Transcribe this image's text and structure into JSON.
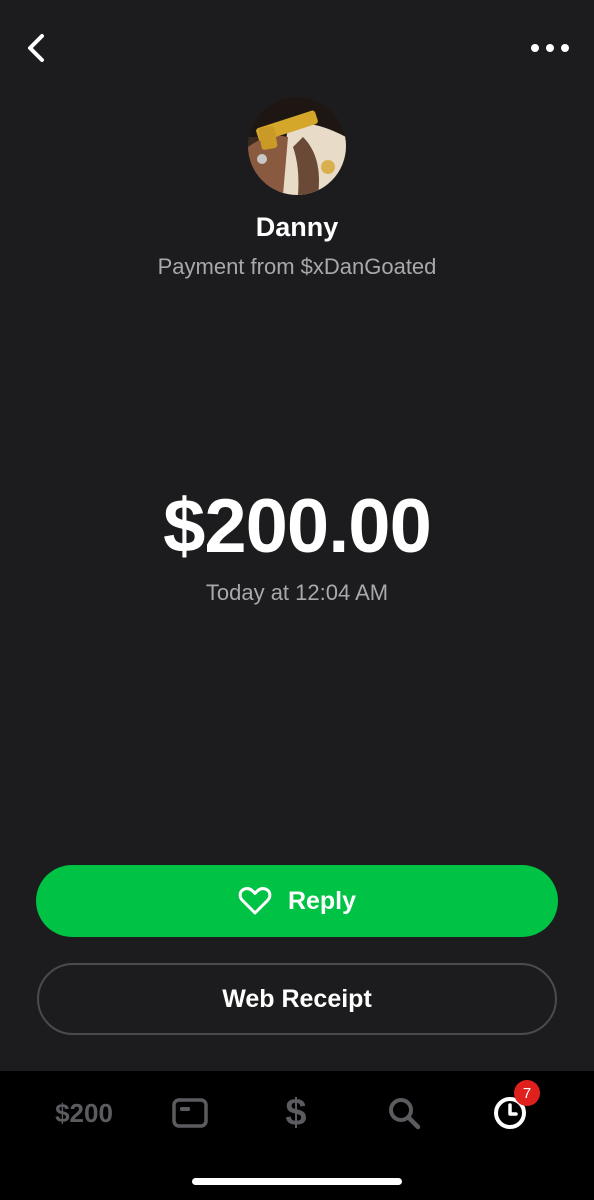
{
  "header": {
    "back_icon": "chevron-left-icon",
    "more_icon": "ellipsis-icon"
  },
  "payment": {
    "sender_name": "Danny",
    "source": "Payment from $xDanGoated",
    "amount": "$200.00",
    "timestamp": "Today at 12:04 AM"
  },
  "actions": {
    "reply_label": "Reply",
    "reply_icon": "heart-outline-icon",
    "receipt_label": "Web Receipt"
  },
  "tab_bar": {
    "balance_label": "$200",
    "card_icon": "card-icon",
    "pay_icon": "dollar-icon",
    "search_icon": "search-icon",
    "activity_icon": "clock-icon",
    "activity_badge": "7"
  },
  "colors": {
    "background": "#1c1c1e",
    "accent_green": "#00c244",
    "badge_red": "#e0201c",
    "secondary_text": "#a8a8ad",
    "inactive_tab": "#5c5c60"
  }
}
